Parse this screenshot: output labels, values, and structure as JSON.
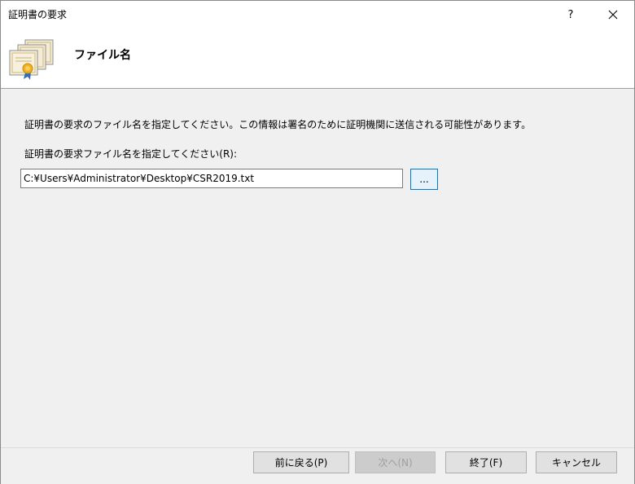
{
  "window": {
    "title": "証明書の要求"
  },
  "titlebar": {
    "help_label": "?"
  },
  "header": {
    "title": "ファイル名",
    "icon": "certificate-icon"
  },
  "main": {
    "description": "証明書の要求のファイル名を指定してください。この情報は署名のために証明機関に送信される可能性があります。",
    "field_label": "証明書の要求ファイル名を指定してください(R):",
    "path_value": "C:¥Users¥Administrator¥Desktop¥CSR2019.txt",
    "browse_label": "..."
  },
  "footer": {
    "back_label": "前に戻る(P)",
    "next_label": "次へ(N)",
    "finish_label": "終了(F)",
    "cancel_label": "キャンセル"
  }
}
